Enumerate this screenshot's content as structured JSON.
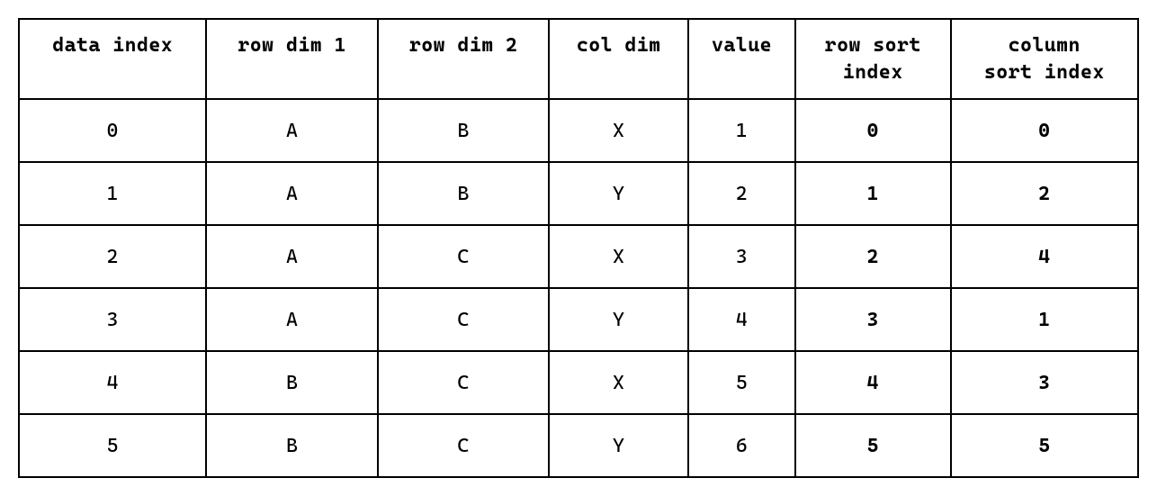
{
  "table": {
    "headers": [
      "data index",
      "row dim 1",
      "row dim 2",
      "col dim",
      "value",
      "row sort\nindex",
      "column\nsort index"
    ],
    "bold_columns": [
      5,
      6
    ],
    "rows": [
      {
        "cells": [
          "0",
          "A",
          "B",
          "X",
          "1",
          "0",
          "0"
        ]
      },
      {
        "cells": [
          "1",
          "A",
          "B",
          "Y",
          "2",
          "1",
          "2"
        ]
      },
      {
        "cells": [
          "2",
          "A",
          "C",
          "X",
          "3",
          "2",
          "4"
        ]
      },
      {
        "cells": [
          "3",
          "A",
          "C",
          "Y",
          "4",
          "3",
          "1"
        ]
      },
      {
        "cells": [
          "4",
          "B",
          "C",
          "X",
          "5",
          "4",
          "3"
        ]
      },
      {
        "cells": [
          "5",
          "B",
          "C",
          "Y",
          "6",
          "5",
          "5"
        ]
      }
    ]
  }
}
